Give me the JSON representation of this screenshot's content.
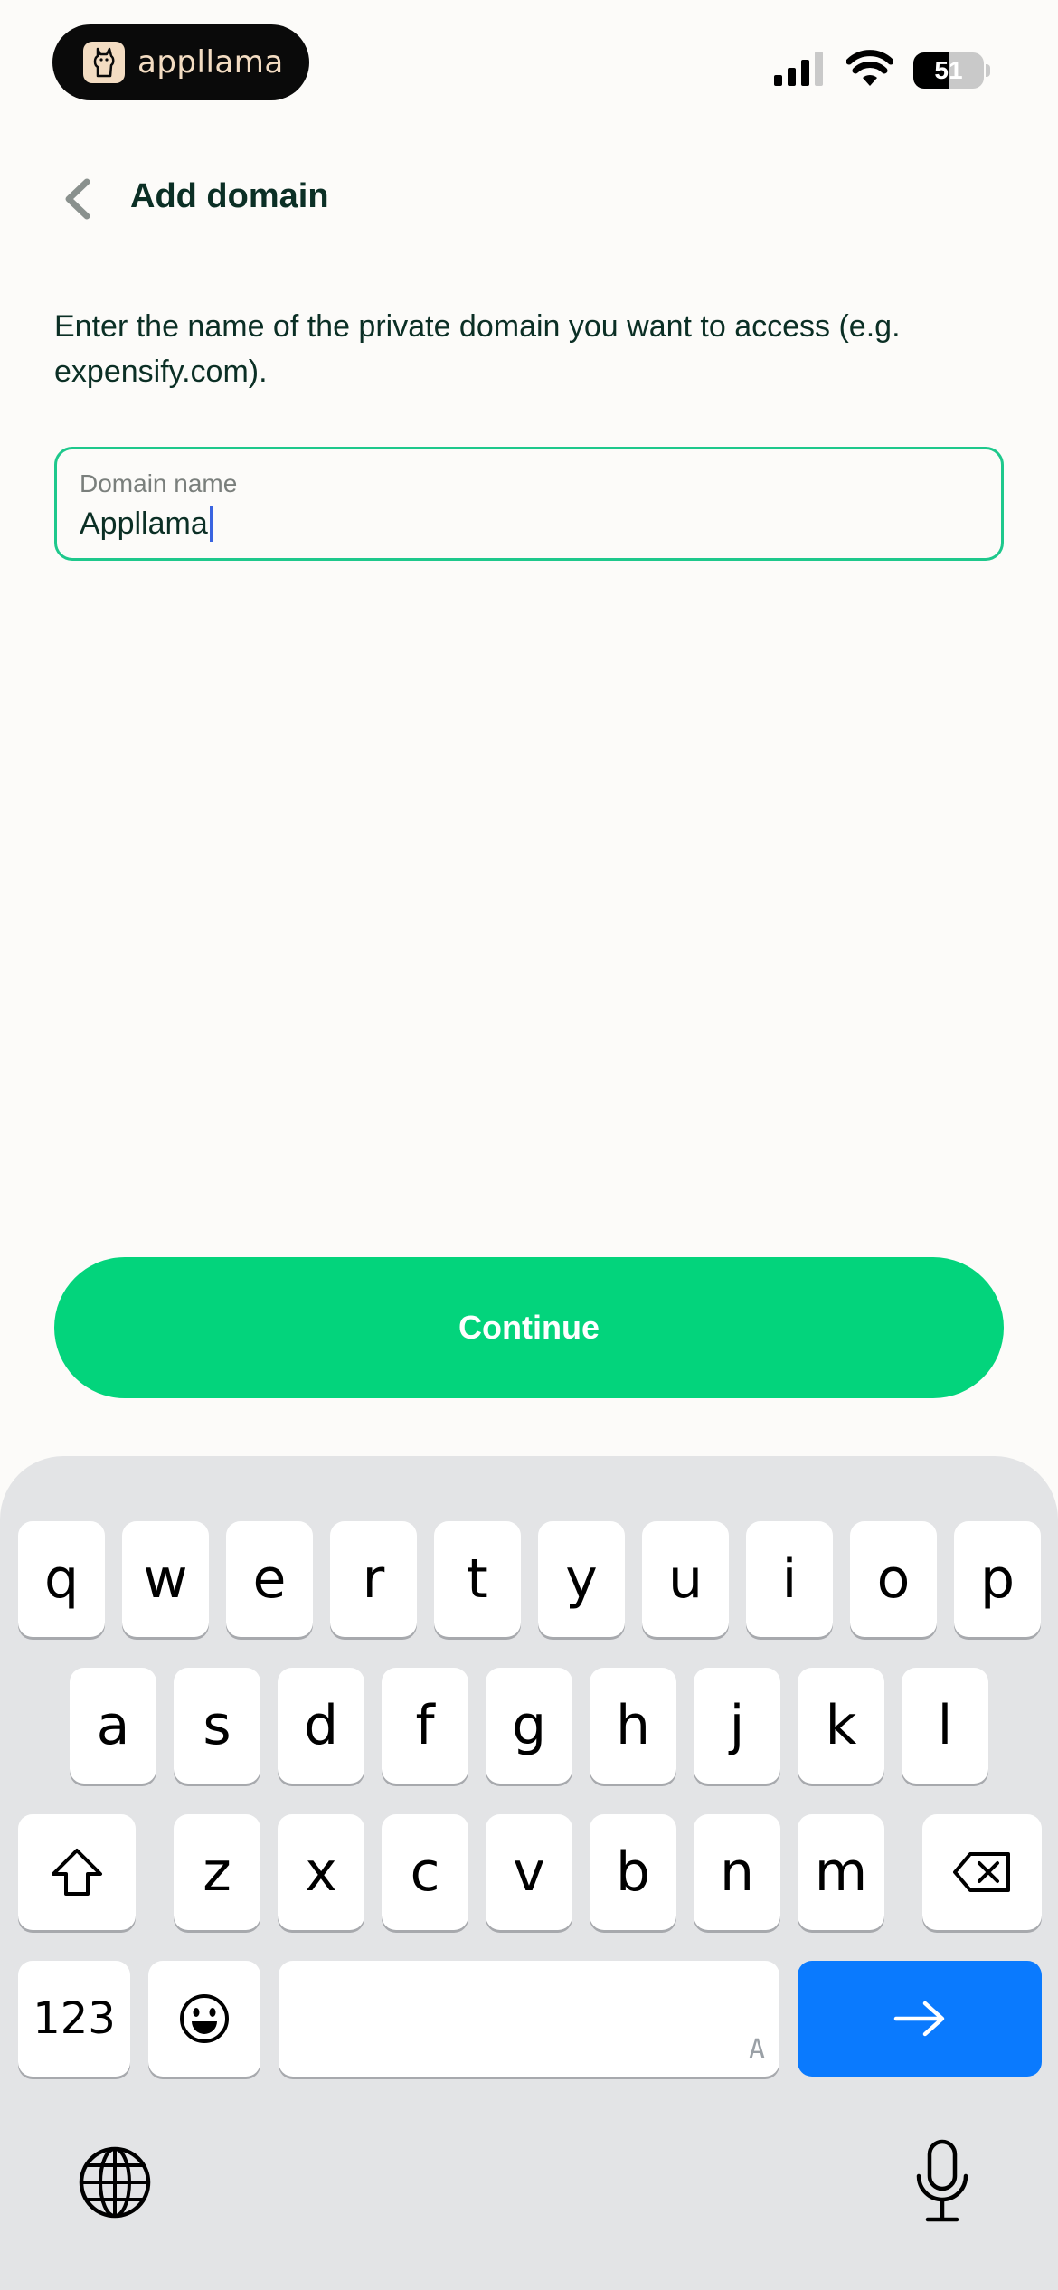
{
  "status_bar": {
    "brand": "appllama",
    "battery_level": "51",
    "battery_fraction": 0.51
  },
  "header": {
    "title": "Add domain",
    "back_icon": "chevron-left-icon"
  },
  "description": "Enter the name of the private domain you want to access (e.g. expensify.com).",
  "domain_field": {
    "label": "Domain name",
    "value": "Appllama"
  },
  "continue_label": "Continue",
  "keyboard": {
    "row1": [
      "q",
      "w",
      "e",
      "r",
      "t",
      "y",
      "u",
      "i",
      "o",
      "p"
    ],
    "row2": [
      "a",
      "s",
      "d",
      "f",
      "g",
      "h",
      "j",
      "k",
      "l"
    ],
    "row3": [
      "z",
      "x",
      "c",
      "v",
      "b",
      "n",
      "m"
    ],
    "numbers_label": "123",
    "space_mark": "A"
  },
  "colors": {
    "accent_green": "#03d47c",
    "field_border": "#1ec88c",
    "go_key_blue": "#0a7afe",
    "text_dark": "#0b2f25"
  }
}
